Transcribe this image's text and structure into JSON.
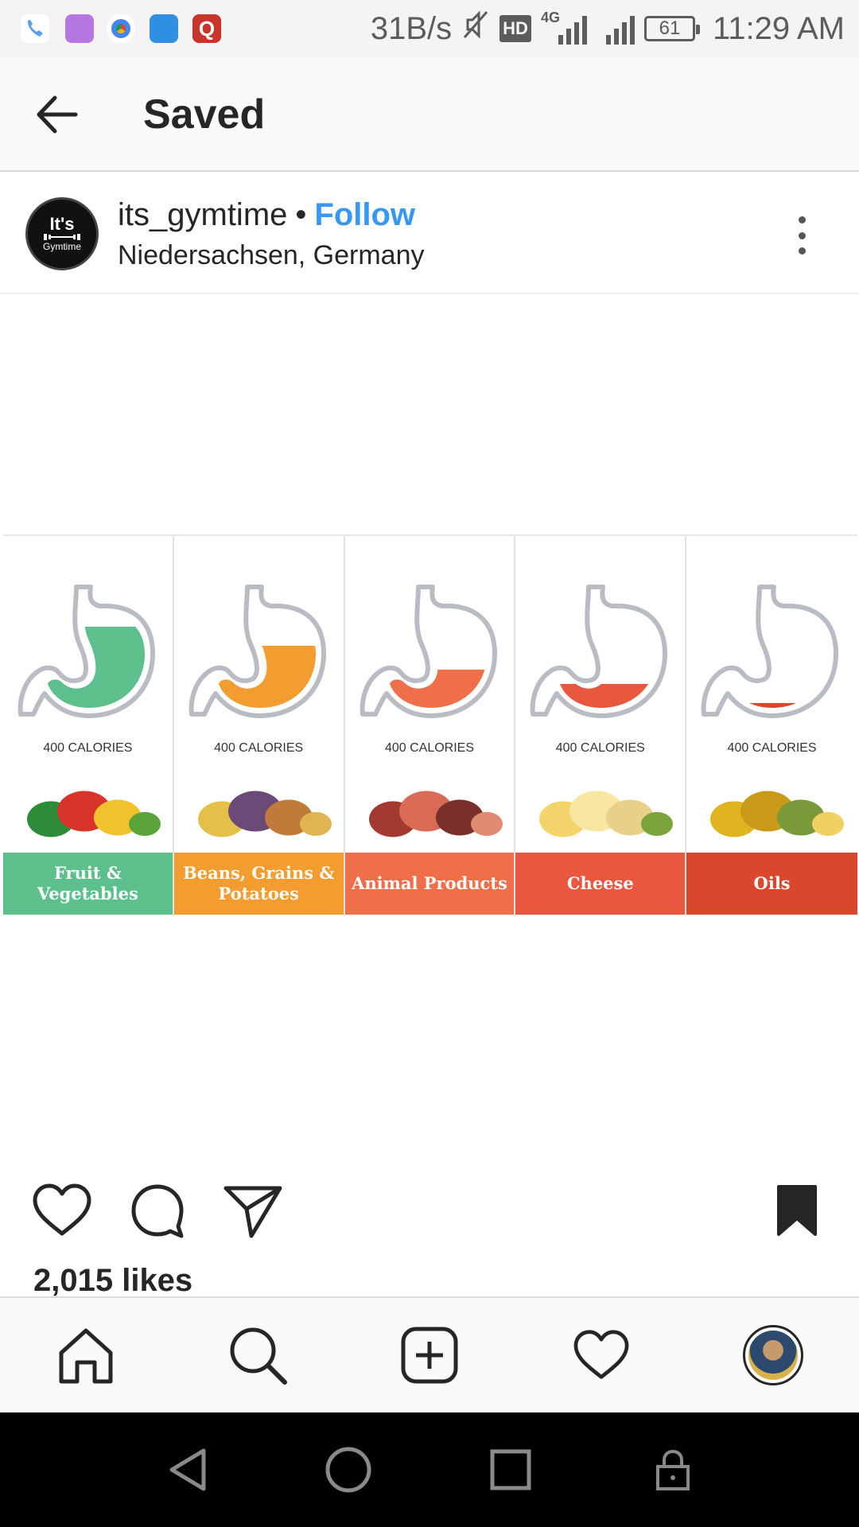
{
  "status_bar": {
    "net_speed": "31B/s",
    "hd": "HD",
    "network": "4G",
    "battery": "61",
    "time": "11:29 AM"
  },
  "header": {
    "title": "Saved"
  },
  "post": {
    "username": "its_gymtime",
    "separator": "•",
    "follow_label": "Follow",
    "location": "Niedersachsen, Germany",
    "avatar_text_1": "It's",
    "avatar_text_2": "Gymtime",
    "likes": "2,015 likes"
  },
  "infographic": {
    "columns": [
      {
        "calories": "400 CALORIES",
        "label": "Fruit & Vegetables",
        "color": "#5dbf8c",
        "fill_level": 0.85
      },
      {
        "calories": "400 CALORIES",
        "label": "Beans, Grains & Potatoes",
        "color": "#f39c2f",
        "fill_level": 0.65
      },
      {
        "calories": "400 CALORIES",
        "label": "Animal Products",
        "color": "#ef6f4a",
        "fill_level": 0.4
      },
      {
        "calories": "400 CALORIES",
        "label": "Cheese",
        "color": "#e9573f",
        "fill_level": 0.25
      },
      {
        "calories": "400 CALORIES",
        "label": "Oils",
        "color": "#d9472c",
        "fill_level": 0.05
      }
    ]
  },
  "icons": {
    "back": "arrow-left-icon",
    "more": "more-vertical-icon",
    "like": "heart-icon",
    "comment": "comment-icon",
    "share": "send-icon",
    "save": "bookmark-filled-icon",
    "home": "home-icon",
    "search": "search-icon",
    "add": "add-post-icon",
    "activity": "heart-icon",
    "profile": "profile-avatar"
  },
  "colors": {
    "follow": "#3897f0",
    "text": "#262626"
  }
}
